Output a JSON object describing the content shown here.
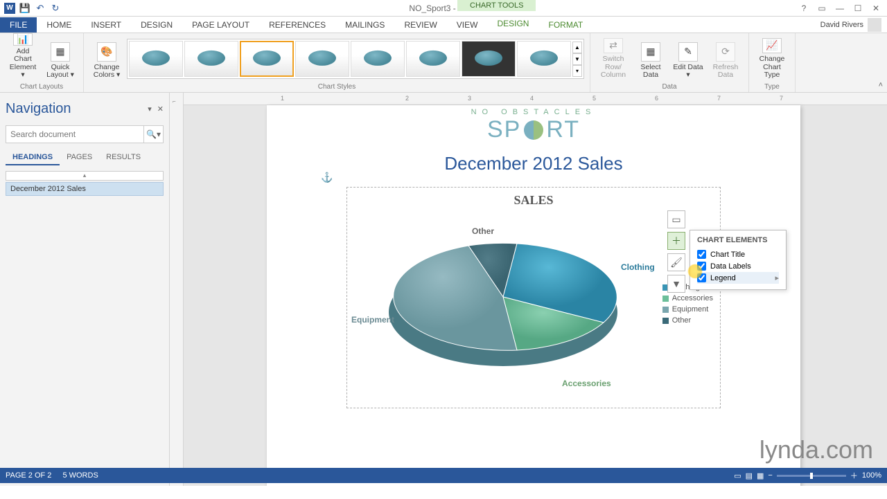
{
  "titlebar": {
    "doc_title": "NO_Sport3 - Word",
    "chart_tools": "CHART TOOLS"
  },
  "user_name": "David Rivers",
  "tabs": {
    "file": "FILE",
    "home": "HOME",
    "insert": "INSERT",
    "design": "DESIGN",
    "page_layout": "PAGE LAYOUT",
    "references": "REFERENCES",
    "mailings": "MAILINGS",
    "review": "REVIEW",
    "view": "VIEW",
    "ctx_design": "DESIGN",
    "ctx_format": "FORMAT"
  },
  "ribbon": {
    "add_element": "Add Chart Element ▾",
    "quick_layout": "Quick Layout ▾",
    "change_colors": "Change Colors ▾",
    "grp_layouts": "Chart Layouts",
    "grp_styles": "Chart Styles",
    "switch_rc": "Switch Row/ Column",
    "select_data": "Select Data",
    "edit_data": "Edit Data ▾",
    "refresh_data": "Refresh Data",
    "grp_data": "Data",
    "change_type": "Change Chart Type",
    "grp_type": "Type"
  },
  "nav": {
    "title": "Navigation",
    "search_placeholder": "Search document",
    "tab_headings": "HEADINGS",
    "tab_pages": "PAGES",
    "tab_results": "RESULTS",
    "heading1": "December 2012 Sales"
  },
  "document": {
    "logo1": "NO OBSTACLES",
    "logo2a": "SP",
    "logo2b": "RT",
    "heading": "December 2012 Sales",
    "chart_title": "SALES"
  },
  "labels": {
    "other": "Other",
    "clothing": "Clothing",
    "equipment": "Equipment",
    "accessories": "Accessories"
  },
  "chart_elements": {
    "title": "CHART ELEMENTS",
    "chart_title": "Chart Title",
    "data_labels": "Data Labels",
    "legend": "Legend"
  },
  "status": {
    "page": "PAGE 2 OF 2",
    "words": "5 WORDS",
    "zoom": "100%"
  },
  "watermark": "lynda.com",
  "colors": {
    "clothing": "#3a95b5",
    "accessories": "#6cbf9a",
    "equipment": "#7aa6ae",
    "other": "#3a6a78"
  },
  "chart_data": {
    "type": "pie",
    "title": "SALES",
    "series": [
      {
        "name": "Clothing",
        "value": 30
      },
      {
        "name": "Accessories",
        "value": 20
      },
      {
        "name": "Equipment",
        "value": 40
      },
      {
        "name": "Other",
        "value": 10
      }
    ],
    "legend_position": "right",
    "data_labels": "category_outside"
  }
}
